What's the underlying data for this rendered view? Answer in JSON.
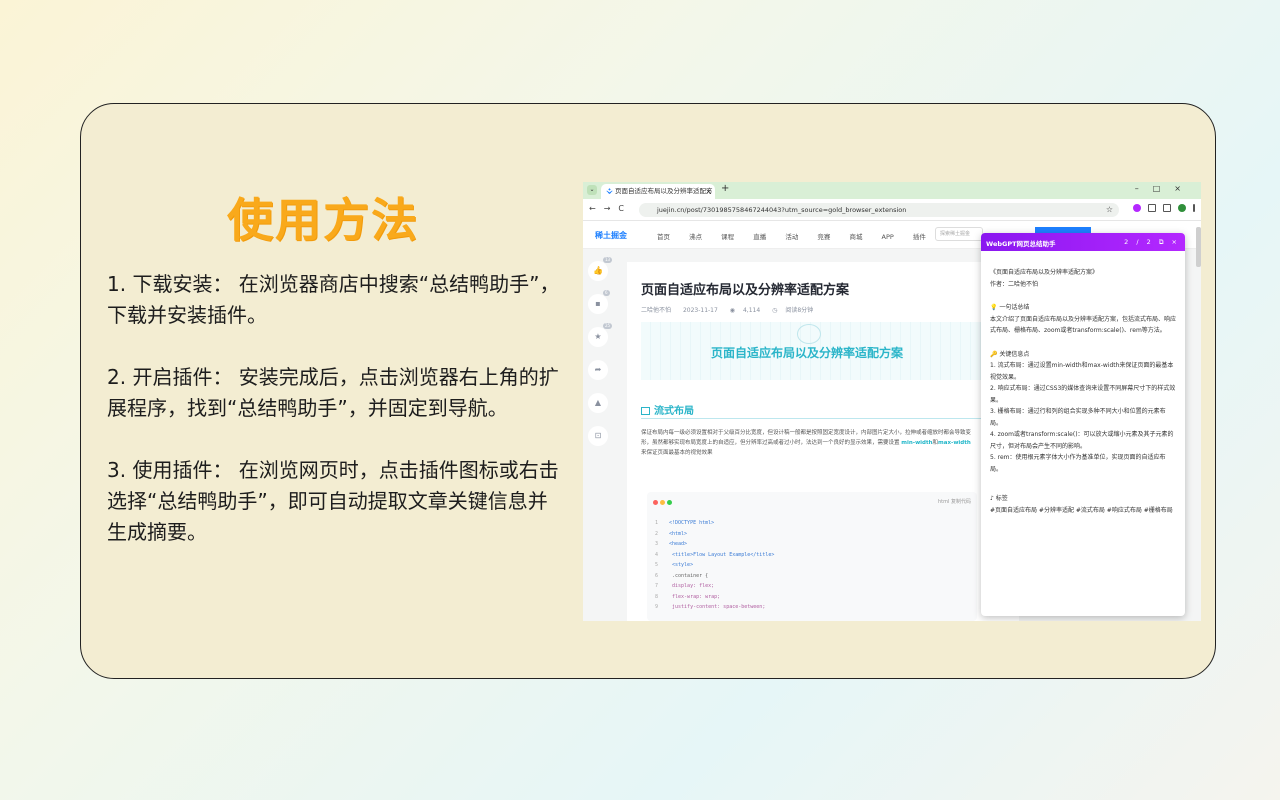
{
  "colors": {
    "title": "#f9a91b",
    "card": "#f3edd2",
    "accent": "#2bb5c9",
    "popup": "#9a1ff6",
    "brand": "#1e80ff"
  },
  "heading": "使用方法",
  "steps": [
    {
      "num": "1.",
      "text": "下载安装： 在浏览器商店中搜索“总结鸭助手”，下载并安装插件。"
    },
    {
      "num": "2.",
      "text": "开启插件： 安装完成后，点击浏览器右上角的扩展程序，找到“总结鸭助手”，并固定到导航。"
    },
    {
      "num": "3.",
      "text": "使用插件： 在浏览网页时，点击插件图标或右击选择“总结鸭助手”，即可自动提取文章关键信息并生成摘要。"
    }
  ],
  "browser": {
    "tab_title": "页面自适应布局以及分辨率适配方",
    "url": "juejin.cn/post/7301985758467244043?utm_source=gold_browser_extension",
    "site_logo": "稀土掘金",
    "nav": [
      "首页",
      "沸点",
      "课程",
      "直播",
      "活动",
      "竞赛",
      "商城",
      "APP",
      "插件"
    ],
    "search_placeholder": "探索稀土掘金",
    "side_badges": [
      "13",
      "6",
      "25"
    ],
    "article": {
      "title": "页面自适应布局以及分辨率适配方案",
      "author": "二哈他不怕",
      "date": "2023-11-17",
      "views": "4,114",
      "read_time": "阅读8分钟",
      "banner": "页面自适应布局以及分辨率适配方案",
      "section": "流式布局",
      "para_1": "保证布局内每一级必须设置相对于父级百分比宽度，但设计稿一般都是按照固定宽度设计，内部图片定大小，拉伸或者缩放时都会导致变形，虽然都够实现布局宽度上的自适应，但分辨率过高或者过小时，法达到一个良好的显示效果，需要设置",
      "code_a": "min-width",
      "and": "和",
      "code_b": "max-width",
      "para_2": "来保证页面最基本的视觉效果",
      "code_hint": "html 复制代码",
      "code": [
        {
          "n": "1",
          "t": "<!DOCTYPE html>"
        },
        {
          "n": "2",
          "t": "<html>"
        },
        {
          "n": "3",
          "t": "<head>"
        },
        {
          "n": "4",
          "t": "  <title>Flow Layout Example</title>"
        },
        {
          "n": "5",
          "t": "  <style>"
        },
        {
          "n": "6",
          "t": "    .container {"
        },
        {
          "n": "7",
          "t": "      display: flex;"
        },
        {
          "n": "8",
          "t": "      flex-wrap: wrap;"
        },
        {
          "n": "9",
          "t": "      justify-content: space-between;"
        }
      ]
    }
  },
  "popup": {
    "title": "WebGPT网页总结助手",
    "pager": "2 / 2",
    "doc_title": "《页面自适应布局以及分辨率适配方案》",
    "author": "作者：二哈他不怕",
    "summary_head": "💡 一句话总结",
    "summary": "本文介绍了页面自适应布局以及分辨率适配方案，包括流式布局、响应式布局、栅格布局、zoom或者transform:scale()、rem等方法。",
    "keys_head": "🔑 关键信息点",
    "keys": [
      "1. 流式布局：通过设置min-width和max-width来保证页面的最基本视觉效果。",
      "2. 响应式布局：通过CSS3的媒体查询来设置不同屏幕尺寸下的样式效果。",
      "3. 栅格布局：通过行和列的组合实现多种不同大小和位置的元素布局。",
      "4. zoom或者transform:scale()：可以放大或缩小元素及其子元素的尺寸，但对布局会产生不同的影响。",
      "5. rem：使用根元素字体大小作为基准单位，实现页面的自适应布局。"
    ],
    "tags_head": "♪ 标签",
    "tags": "#页面自适应布局 #分辨率适配 #流式布局 #响应式布局 #栅格布局"
  }
}
